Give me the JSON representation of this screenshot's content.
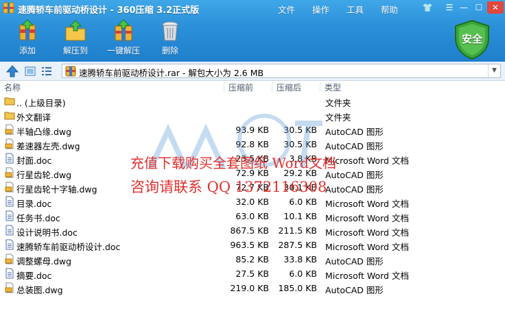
{
  "window": {
    "title": "速腾轿车前驱动桥设计 - 360压缩 3.2正式版",
    "menus": [
      "文件",
      "操作",
      "工具",
      "帮助"
    ],
    "controls": {
      "skin": "👕",
      "menu": "☰",
      "minimize": "—",
      "maximize": "☐",
      "close": "✕"
    }
  },
  "toolbar": {
    "add_label": "添加",
    "extract_label": "解压到",
    "oneclick_label": "一键解压",
    "delete_label": "删除",
    "safety_label": "安全"
  },
  "address": {
    "path": "速腾轿车前驱动桥设计.rar - 解包大小为 2.6 MB"
  },
  "columns": {
    "name": "名称",
    "compressed": "压缩前",
    "packed": "压缩后",
    "type": "类型"
  },
  "rows": [
    {
      "icon": "folder-up-icon",
      "name": ".. (上级目录)",
      "compressed": "",
      "packed": "",
      "type": "文件夹"
    },
    {
      "icon": "folder-icon",
      "name": "外文翻译",
      "compressed": "",
      "packed": "",
      "type": "文件夹"
    },
    {
      "icon": "dwg-file-icon",
      "name": "半轴凸缘.dwg",
      "compressed": "93.9 KB",
      "packed": "30.5 KB",
      "type": "AutoCAD 图形"
    },
    {
      "icon": "dwg-file-icon",
      "name": "差速器左壳.dwg",
      "compressed": "92.8 KB",
      "packed": "30.5 KB",
      "type": "AutoCAD 图形"
    },
    {
      "icon": "doc-file-icon",
      "name": "封面.doc",
      "compressed": "23.5 KB",
      "packed": "3.8 KB",
      "type": "Microsoft Word 文档"
    },
    {
      "icon": "dwg-file-icon",
      "name": "行星齿轮.dwg",
      "compressed": "72.9 KB",
      "packed": "29.2 KB",
      "type": "AutoCAD 图形"
    },
    {
      "icon": "dwg-file-icon",
      "name": "行星齿轮十字轴.dwg",
      "compressed": "72.7 KB",
      "packed": "30.1 KB",
      "type": "AutoCAD 图形"
    },
    {
      "icon": "doc-file-icon",
      "name": "目录.doc",
      "compressed": "32.0 KB",
      "packed": "6.0 KB",
      "type": "Microsoft Word 文档"
    },
    {
      "icon": "doc-file-icon",
      "name": "任务书.doc",
      "compressed": "63.0 KB",
      "packed": "10.1 KB",
      "type": "Microsoft Word 文档"
    },
    {
      "icon": "doc-file-icon",
      "name": "设计说明书.doc",
      "compressed": "867.5 KB",
      "packed": "211.5 KB",
      "type": "Microsoft Word 文档"
    },
    {
      "icon": "doc-file-icon",
      "name": "速腾轿车前驱动桥设计.doc",
      "compressed": "963.5 KB",
      "packed": "287.5 KB",
      "type": "Microsoft Word 文档"
    },
    {
      "icon": "dwg-file-icon",
      "name": "调整螺母.dwg",
      "compressed": "85.2 KB",
      "packed": "33.8 KB",
      "type": "AutoCAD 图形"
    },
    {
      "icon": "doc-file-icon",
      "name": "摘要.doc",
      "compressed": "27.5 KB",
      "packed": "6.0 KB",
      "type": "Microsoft Word 文档"
    },
    {
      "icon": "dwg-file-icon",
      "name": "总装图.dwg",
      "compressed": "219.0 KB",
      "packed": "185.0 KB",
      "type": "AutoCAD 图形"
    }
  ],
  "watermark": {
    "line1": "充值下载购买全套图纸 Word文档",
    "line2": "咨询请联系  QQ 1372116308"
  },
  "colors": {
    "title_bar": "#2b8fd8",
    "watermark_text": "#e0312e",
    "close_button": "#e2463c",
    "safety_shield": "#3aa63a"
  }
}
